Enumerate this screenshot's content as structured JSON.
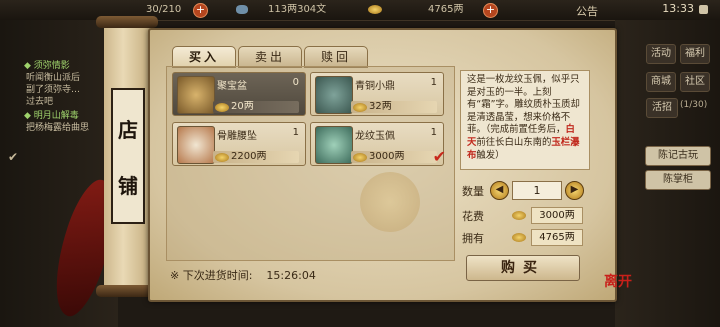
{
  "topbar": {
    "stat1": "30/210",
    "stat2": "113两304文",
    "stat3": "4765两",
    "announce": "公告",
    "time": "13:33"
  },
  "left_quests": {
    "q1_title": "须弥情影",
    "q1_lines": [
      "听闻衡山派后",
      "副了须弥寺…",
      "过去吧"
    ],
    "q2_title": "明月山解毒",
    "q2_lines": [
      "把杨梅露给曲思"
    ]
  },
  "right_menu": {
    "b1": "活动",
    "b2": "福利",
    "b3": "商城",
    "b4": "社区",
    "b5": "活招",
    "b5_count": "(1/30)",
    "panel1": "陈记古玩",
    "panel2": "陈掌柜"
  },
  "scroll": {
    "char1": "店",
    "char2": "铺"
  },
  "tabs": {
    "buy": "买入",
    "sell": "卖出",
    "redeem": "赎回"
  },
  "items": [
    {
      "name": "聚宝盆",
      "count": "0",
      "price": "20两"
    },
    {
      "name": "青铜小鼎",
      "count": "1",
      "price": "32两"
    },
    {
      "name": "骨雕腰坠",
      "count": "1",
      "price": "2200两"
    },
    {
      "name": "龙纹玉佩",
      "count": "1",
      "price": "3000两"
    }
  ],
  "restock": {
    "label": "※ 下次进货时间:",
    "time": "15:26:04"
  },
  "detail": {
    "desc_1": "这是一枚龙纹玉佩，似乎只是对玉的一半。上刻有“霜”字。雕纹质朴玉质却是清透晶莹，想来价格不菲。（完成前置任务后，",
    "desc_red1": "白天",
    "desc_2": "前往长白山东南的",
    "desc_red2": "玉栏瀑布",
    "desc_3": "触发）",
    "qty_label": "数量",
    "qty_value": "1",
    "cost_label": "花费",
    "cost_value": "3000两",
    "own_label": "拥有",
    "own_value": "4765两",
    "buy_button": "购买",
    "leave": "离开"
  }
}
